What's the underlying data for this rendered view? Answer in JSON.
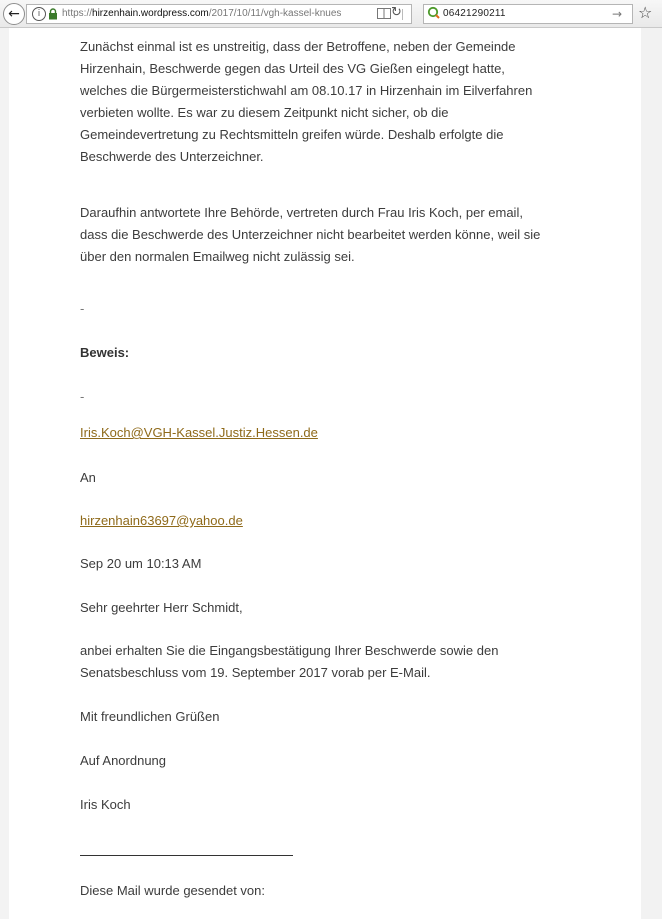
{
  "browser": {
    "url_prefix": "https://",
    "url_domain": "hirzenhain.wordpress.com",
    "url_path": "/2017/10/11/vgh-kassel-knues",
    "search_value": "06421290211"
  },
  "email": {
    "paragraph1": [
      "Zunächst einmal ist es unstreitig, dass der Betroffene, neben der Gemeinde",
      "Hirzenhain, Beschwerde gegen das Urteil des VG Gießen eingelegt hatte,",
      "welches die Bürgermeisterstichwahl am 08.10.17  in Hirzenhain im Eilverfahren",
      "verbieten wollte. Es war zu diesem Zeitpunkt nicht sicher, ob die",
      "Gemeindevertretung zu Rechtsmitteln greifen würde. Deshalb erfolgte die",
      "Beschwerde des Unterzeichner."
    ],
    "paragraph2": [
      "Daraufhin antwortete Ihre Behörde, vertreten durch Frau Iris Koch, per email,",
      "dass die Beschwerde des Unterzeichner nicht bearbeitet werden könne, weil sie",
      "über den normalen Emailweg nicht zulässig sei."
    ],
    "dash": "-",
    "proof_label": "Beweis:",
    "from_link": "Iris.Koch@VGH-Kassel.Justiz.Hessen.de",
    "to_label": "An",
    "to_link": "hirzenhain63697@yahoo.de",
    "date": "Sep 20 um 10:13 AM",
    "salutation": "Sehr geehrter Herr Schmidt,",
    "body": [
      "anbei erhalten Sie die Eingangsbestätigung Ihrer Beschwerde sowie den",
      "Senatsbeschluss vom 19. September 2017 vorab per E-Mail."
    ],
    "closing": "Mit freundlichen Grüßen",
    "order": "Auf Anordnung",
    "signature": "Iris Koch",
    "sent_by": "Diese Mail wurde gesendet von:"
  }
}
